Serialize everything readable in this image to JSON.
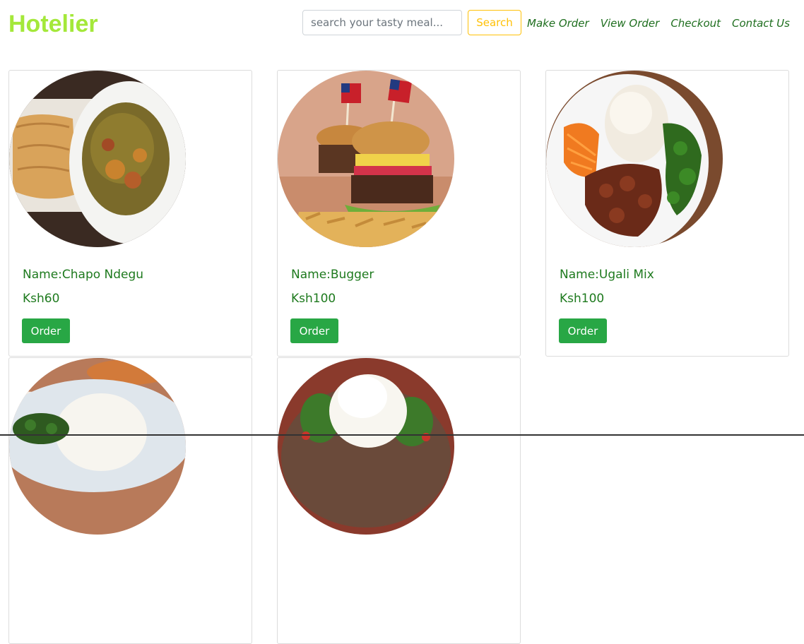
{
  "brand": "Hotelier",
  "search": {
    "placeholder": "search your tasty meal...",
    "button_label": "Search"
  },
  "nav": {
    "links": [
      "Make Order",
      "View Order",
      "Checkout",
      "Contact Us"
    ]
  },
  "colors": {
    "brand": "#a4e83a",
    "search_button": "#ffc107",
    "nav_text": "#1e6e1e",
    "product_text": "#1e7a1e",
    "order_button": "#28a745"
  },
  "products": [
    {
      "name": "Name:Chapo Ndegu",
      "price": "Ksh60",
      "order_label": "Order",
      "image": "chapo-ndegu-photo"
    },
    {
      "name": "Name:Bugger",
      "price": "Ksh100",
      "order_label": "Order",
      "image": "burger-photo"
    },
    {
      "name": "Name:Ugali Mix",
      "price": "Ksh100",
      "order_label": "Order",
      "image": "ugali-mix-photo"
    },
    {
      "name": "",
      "price": "",
      "order_label": "",
      "image": "ugali-sukuma-photo"
    },
    {
      "name": "",
      "price": "",
      "order_label": "",
      "image": "ugali-greens-photo"
    }
  ]
}
